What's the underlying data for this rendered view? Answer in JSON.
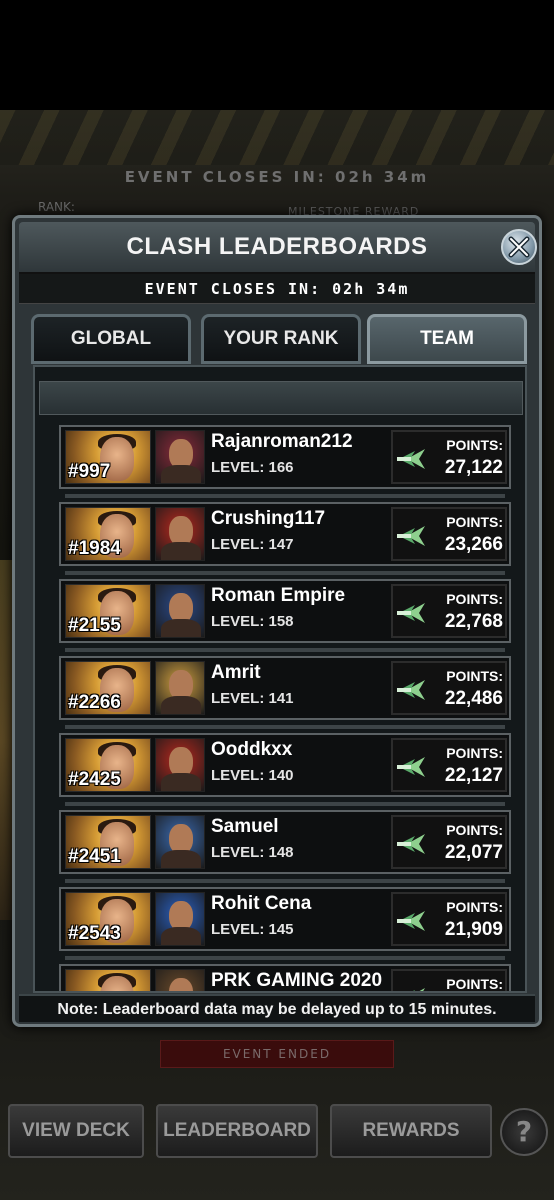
{
  "background": {
    "event_closes": "EVENT CLOSES IN: 02h 34m",
    "rank_label": "RANK:",
    "milestone_label": "MILESTONE REWARD",
    "event_ended": "EVENT ENDED",
    "buttons": {
      "view_deck": "VIEW DECK",
      "leaderboard": "LEADERBOARD",
      "rewards": "REWARDS",
      "help": "?"
    }
  },
  "modal": {
    "title": "CLASH LEADERBOARDS",
    "closes": "EVENT CLOSES IN: 02h 34m",
    "tabs": [
      {
        "label": "GLOBAL",
        "active": false
      },
      {
        "label": "YOUR RANK",
        "active": false
      },
      {
        "label": "TEAM",
        "active": true
      }
    ],
    "points_label": "POINTS:",
    "entries": [
      {
        "rank": "#997",
        "name": "Rajanroman212",
        "level": "LEVEL: 166",
        "points": "27,122",
        "avatar_color": "#8a2a3a"
      },
      {
        "rank": "#1984",
        "name": "Crushing117",
        "level": "LEVEL: 147",
        "points": "23,266",
        "avatar_color": "#b8281e"
      },
      {
        "rank": "#2155",
        "name": "Roman Empire",
        "level": "LEVEL: 158",
        "points": "22,768",
        "avatar_color": "#2a4a8a"
      },
      {
        "rank": "#2266",
        "name": "Amrit",
        "level": "LEVEL: 141",
        "points": "22,486",
        "avatar_color": "#d0a040"
      },
      {
        "rank": "#2425",
        "name": "Ooddkxx",
        "level": "LEVEL: 140",
        "points": "22,127",
        "avatar_color": "#b8281e"
      },
      {
        "rank": "#2451",
        "name": "Samuel",
        "level": "LEVEL: 148",
        "points": "22,077",
        "avatar_color": "#3a6ab0"
      },
      {
        "rank": "#2543",
        "name": "Rohit Cena",
        "level": "LEVEL: 145",
        "points": "21,909",
        "avatar_color": "#2a60c0"
      },
      {
        "rank": "",
        "name": "PRK GAMING 2020",
        "level": "",
        "points": "",
        "avatar_color": "#6a4a2a"
      }
    ],
    "note": "Note: Leaderboard data may be delayed up to 15 minutes."
  },
  "colors": {
    "modal_bg": "#2e3538",
    "accent_points": "#6fc08a",
    "event_ended_bg": "#3a0c0c"
  },
  "icons": {
    "close": "close-x-icon",
    "points": "chevron-points-icon",
    "help": "question-mark-icon"
  }
}
